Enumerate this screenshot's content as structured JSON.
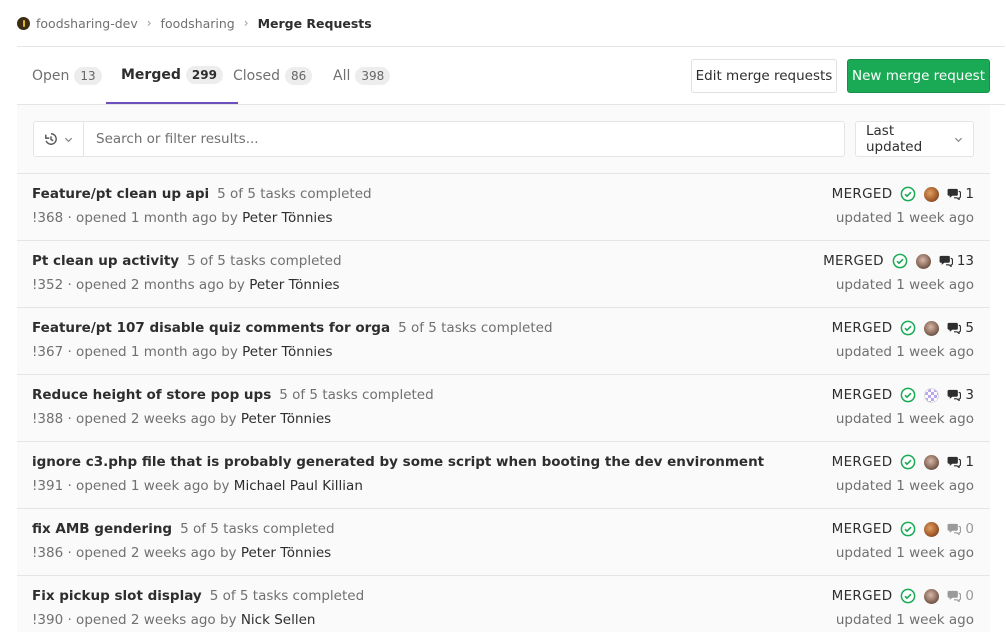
{
  "breadcrumb": {
    "group": "foodsharing-dev",
    "project": "foodsharing",
    "current": "Merge Requests"
  },
  "tabs": [
    {
      "label": "Open",
      "count": "13"
    },
    {
      "label": "Merged",
      "count": "299"
    },
    {
      "label": "Closed",
      "count": "86"
    },
    {
      "label": "All",
      "count": "398"
    }
  ],
  "buttons": {
    "edit": "Edit merge requests",
    "new": "New merge request"
  },
  "filter": {
    "placeholder": "Search or filter results...",
    "sort": "Last updated"
  },
  "colors": {
    "success": "#1aaa55",
    "active_tab": "#6b4fbb"
  },
  "merge_requests": [
    {
      "title": "Feature/pt clean up api",
      "tasks": "5 of 5 tasks completed",
      "meta_prefix": "!368 · opened 1 month ago by ",
      "author": "Peter Tönnies",
      "status": "MERGED",
      "comments": "1",
      "updated": "updated 1 week ago"
    },
    {
      "title": "Pt clean up activity",
      "tasks": "5 of 5 tasks completed",
      "meta_prefix": "!352 · opened 2 months ago by ",
      "author": "Peter Tönnies",
      "status": "MERGED",
      "comments": "13",
      "updated": "updated 1 week ago"
    },
    {
      "title": "Feature/pt 107 disable quiz comments for orga",
      "tasks": "5 of 5 tasks completed",
      "meta_prefix": "!367 · opened 1 month ago by ",
      "author": "Peter Tönnies",
      "status": "MERGED",
      "comments": "5",
      "updated": "updated 1 week ago"
    },
    {
      "title": "Reduce height of store pop ups",
      "tasks": "5 of 5 tasks completed",
      "meta_prefix": "!388 · opened 2 weeks ago by ",
      "author": "Peter Tönnies",
      "status": "MERGED",
      "comments": "3",
      "updated": "updated 1 week ago"
    },
    {
      "title": "ignore c3.php file that is probably generated by some script when booting the dev environment",
      "tasks": "",
      "meta_prefix": "!391 · opened 1 week ago by ",
      "author": "Michael Paul Killian",
      "status": "MERGED",
      "comments": "1",
      "updated": "updated 1 week ago"
    },
    {
      "title": "fix AMB gendering",
      "tasks": "5 of 5 tasks completed",
      "meta_prefix": "!386 · opened 2 weeks ago by ",
      "author": "Peter Tönnies",
      "status": "MERGED",
      "comments": "0",
      "updated": "updated 1 week ago"
    },
    {
      "title": "Fix pickup slot display",
      "tasks": "5 of 5 tasks completed",
      "meta_prefix": "!390 · opened 2 weeks ago by ",
      "author": "Nick Sellen",
      "status": "MERGED",
      "comments": "0",
      "updated": "updated 1 week ago"
    }
  ]
}
